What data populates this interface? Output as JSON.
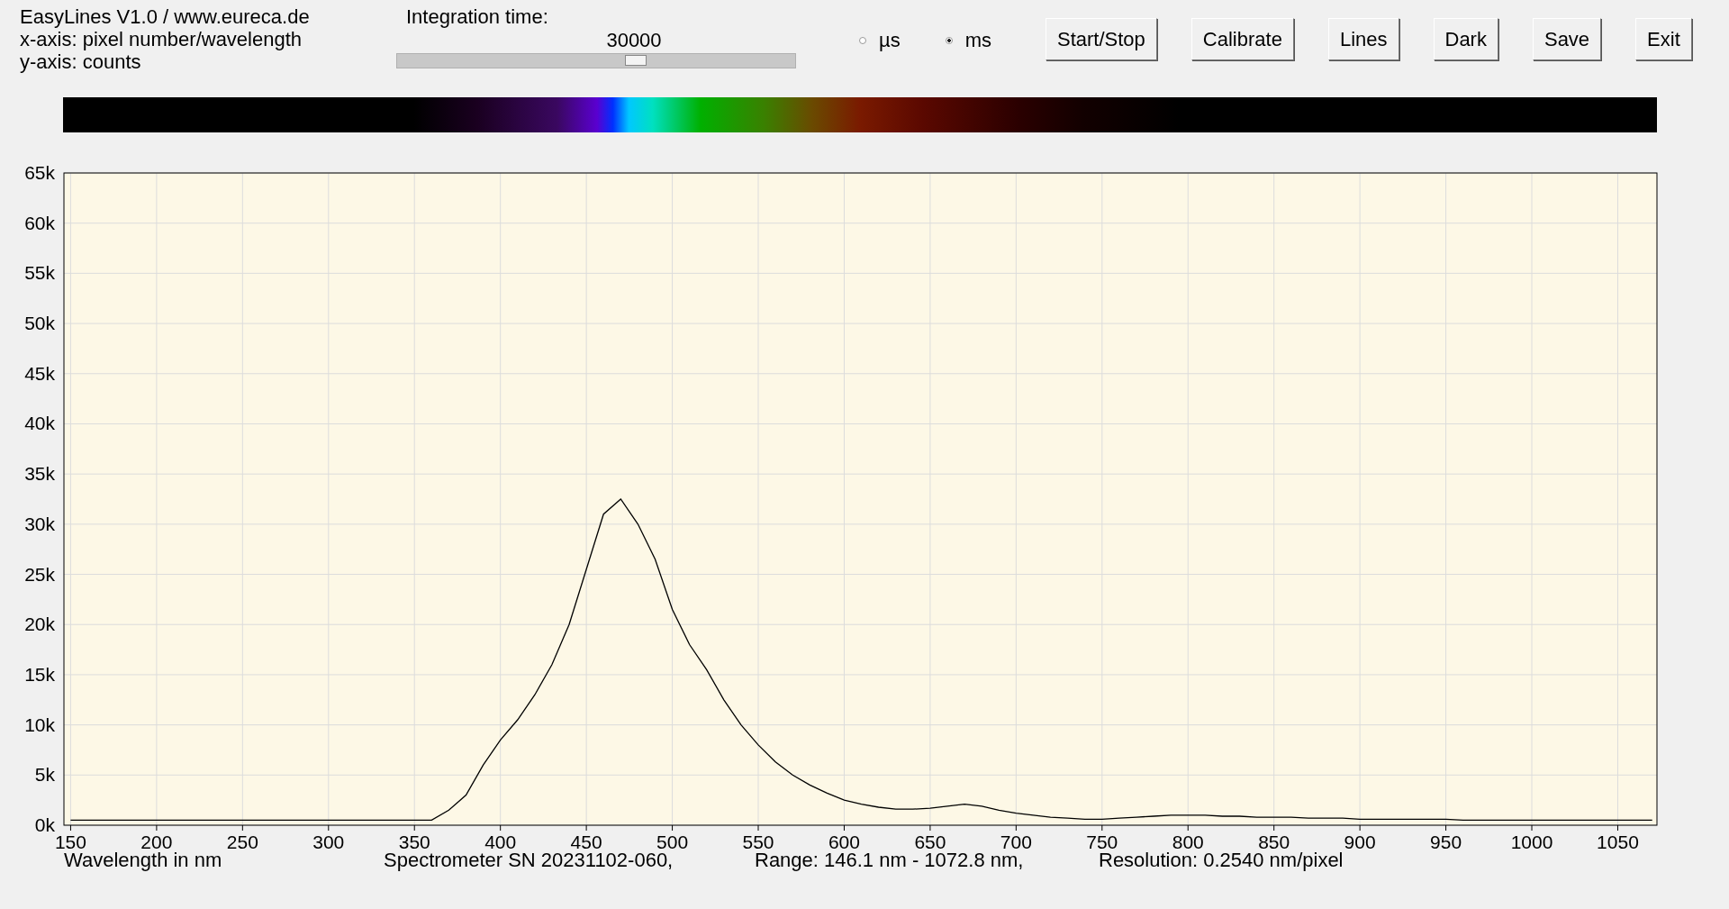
{
  "header": {
    "lines": [
      "EasyLines V1.0 / www.eureca.de",
      "x-axis: pixel number/wavelength",
      "y-axis: counts"
    ]
  },
  "integration": {
    "label": "Integration time:",
    "value": "30000",
    "level": 0.6
  },
  "units": [
    {
      "label": "µs",
      "selected": false
    },
    {
      "label": "ms",
      "selected": true
    }
  ],
  "buttons": [
    "Start/Stop",
    "Calibrate",
    "Lines",
    "Dark",
    "Save",
    "Exit"
  ],
  "chart_data": {
    "type": "line",
    "xlabel": "Wavelength in nm",
    "grid": true,
    "xlim": [
      146.1,
      1072.8
    ],
    "ylim": [
      0,
      65000
    ],
    "xticks": [
      150,
      200,
      250,
      300,
      350,
      400,
      450,
      500,
      550,
      600,
      650,
      700,
      750,
      800,
      850,
      900,
      950,
      1000,
      1050
    ],
    "yticks": [
      {
        "value": 0,
        "label": "0k"
      },
      {
        "value": 5000,
        "label": "5k"
      },
      {
        "value": 10000,
        "label": "10k"
      },
      {
        "value": 15000,
        "label": "15k"
      },
      {
        "value": 20000,
        "label": "20k"
      },
      {
        "value": 25000,
        "label": "25k"
      },
      {
        "value": 30000,
        "label": "30k"
      },
      {
        "value": 35000,
        "label": "35k"
      },
      {
        "value": 40000,
        "label": "40k"
      },
      {
        "value": 45000,
        "label": "45k"
      },
      {
        "value": 50000,
        "label": "50k"
      },
      {
        "value": 55000,
        "label": "55k"
      },
      {
        "value": 60000,
        "label": "60k"
      },
      {
        "value": 65000,
        "label": "65k"
      }
    ],
    "x": [
      150,
      160,
      170,
      180,
      190,
      200,
      210,
      220,
      230,
      240,
      250,
      260,
      270,
      280,
      290,
      300,
      310,
      320,
      330,
      340,
      350,
      360,
      370,
      380,
      390,
      400,
      410,
      420,
      430,
      440,
      450,
      460,
      470,
      480,
      490,
      500,
      510,
      520,
      530,
      540,
      550,
      560,
      570,
      580,
      590,
      600,
      610,
      620,
      630,
      640,
      650,
      660,
      670,
      680,
      690,
      700,
      710,
      720,
      730,
      740,
      750,
      760,
      770,
      780,
      790,
      800,
      810,
      820,
      830,
      840,
      850,
      860,
      870,
      880,
      890,
      900,
      910,
      920,
      930,
      940,
      950,
      960,
      970,
      980,
      990,
      1000,
      1010,
      1020,
      1030,
      1040,
      1050,
      1060,
      1070
    ],
    "series": [
      {
        "color": "#000000",
        "values": [
          500,
          500,
          500,
          500,
          500,
          500,
          500,
          500,
          500,
          500,
          500,
          500,
          500,
          500,
          500,
          500,
          500,
          500,
          500,
          500,
          500,
          500,
          1500,
          3000,
          6000,
          8500,
          10500,
          13000,
          16000,
          20000,
          25500,
          31000,
          32500,
          30000,
          26500,
          21500,
          18000,
          15500,
          12500,
          10000,
          8000,
          6300,
          5000,
          4000,
          3200,
          2500,
          2100,
          1800,
          1600,
          1600,
          1700,
          1900,
          2100,
          1900,
          1500,
          1200,
          1000,
          800,
          700,
          600,
          600,
          700,
          800,
          900,
          1000,
          1000,
          1000,
          900,
          900,
          800,
          800,
          800,
          700,
          700,
          700,
          600,
          600,
          600,
          600,
          600,
          600,
          500,
          500,
          500,
          500,
          500,
          500,
          500,
          500,
          500,
          500,
          500,
          500
        ]
      }
    ]
  },
  "footer": [
    "Spectrometer SN 20231102-060,",
    "Range: 146.1 nm - 1072.8 nm,",
    "Resolution: 0.2540 nm/pixel"
  ]
}
